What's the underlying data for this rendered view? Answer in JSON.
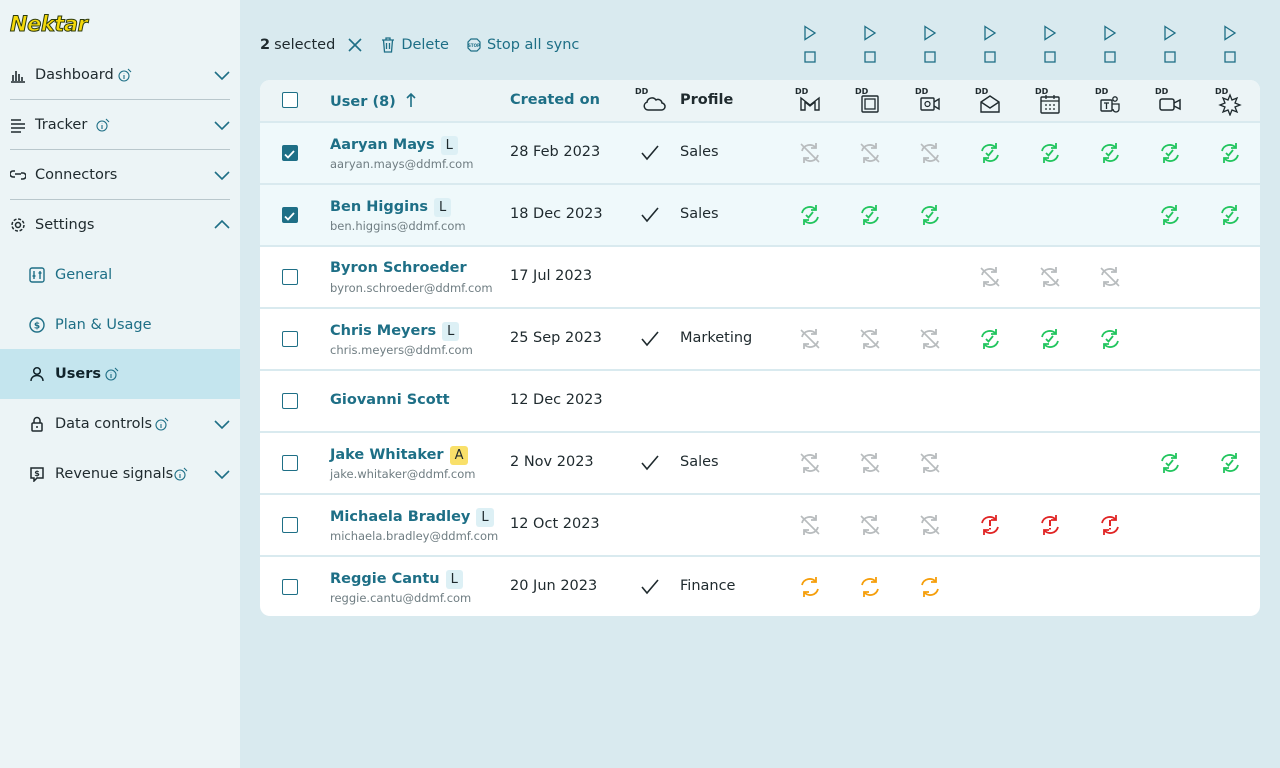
{
  "app": {
    "logo": "Nektar"
  },
  "sidebar": {
    "items": [
      {
        "label": "Dashboard",
        "icon": "bar-chart-icon",
        "info": true,
        "chevron": "down"
      },
      {
        "label": "Tracker",
        "icon": "tracker-list-icon",
        "info": true,
        "chevron": "down"
      },
      {
        "label": "Connectors",
        "icon": "connector-icon",
        "info": false,
        "chevron": "down"
      },
      {
        "label": "Settings",
        "icon": "gear-icon",
        "info": false,
        "chevron": "up"
      },
      {
        "label": "General",
        "icon": "sliders-icon",
        "sub": true
      },
      {
        "label": "Plan & Usage",
        "icon": "dollar-icon",
        "sub": true
      },
      {
        "label": "Users",
        "icon": "user-icon",
        "sub": true,
        "active": true,
        "info": true
      },
      {
        "label": "Data controls",
        "icon": "lock-icon",
        "sub": true,
        "info": true,
        "chevron": "down"
      },
      {
        "label": "Revenue signals",
        "icon": "signal-icon",
        "sub": true,
        "info": true,
        "chevron": "down"
      }
    ]
  },
  "toolbar": {
    "selected_count": "2",
    "selected_label": "selected",
    "delete_label": "Delete",
    "stop_sync_label": "Stop all sync"
  },
  "table": {
    "headers": {
      "user": "User (8)",
      "created": "Created on",
      "profile": "Profile",
      "dd": "DD"
    },
    "sync_columns": [
      {
        "icon": "salesforce-cloud-icon"
      },
      {
        "icon": "gmail-icon"
      },
      {
        "icon": "outlook-icon"
      },
      {
        "icon": "video-meeting-icon"
      },
      {
        "icon": "email-icon"
      },
      {
        "icon": "calendar-icon"
      },
      {
        "icon": "teams-icon"
      },
      {
        "icon": "zoom-icon"
      },
      {
        "icon": "spark-icon"
      }
    ],
    "rows": [
      {
        "name": "Aaryan Mays",
        "badge": "L",
        "email": "aaryan.mays@ddmf.com",
        "created": "28 Feb 2023",
        "dd": true,
        "profile": "Sales",
        "selected": true,
        "sync": [
          "off",
          "off",
          "off",
          "ok",
          "ok",
          "ok",
          "ok",
          "ok"
        ]
      },
      {
        "name": "Ben Higgins",
        "badge": "L",
        "email": "ben.higgins@ddmf.com",
        "created": "18 Dec 2023",
        "dd": true,
        "profile": "Sales",
        "selected": true,
        "sync": [
          "ok",
          "ok",
          "ok",
          "",
          "",
          "",
          "ok",
          "ok"
        ]
      },
      {
        "name": "Byron Schroeder",
        "badge": "",
        "email": "byron.schroeder@ddmf.com",
        "created": "17 Jul 2023",
        "dd": false,
        "profile": "",
        "selected": false,
        "sync": [
          "",
          "",
          "",
          "off",
          "off",
          "off",
          "",
          ""
        ]
      },
      {
        "name": "Chris Meyers",
        "badge": "L",
        "email": "chris.meyers@ddmf.com",
        "created": "25 Sep 2023",
        "dd": true,
        "profile": "Marketing",
        "selected": false,
        "sync": [
          "off",
          "off",
          "off",
          "ok",
          "ok",
          "ok",
          "",
          ""
        ]
      },
      {
        "name": "Giovanni Scott",
        "badge": "",
        "email": "",
        "created": "12 Dec 2023",
        "dd": false,
        "profile": "",
        "selected": false,
        "sync": [
          "",
          "",
          "",
          "",
          "",
          "",
          "",
          ""
        ]
      },
      {
        "name": "Jake Whitaker",
        "badge": "A",
        "email": "jake.whitaker@ddmf.com",
        "created": "2 Nov 2023",
        "dd": true,
        "profile": "Sales",
        "selected": false,
        "sync": [
          "off",
          "off",
          "off",
          "",
          "",
          "",
          "ok",
          "ok"
        ]
      },
      {
        "name": "Michaela Bradley",
        "badge": "L",
        "email": "michaela.bradley@ddmf.com",
        "created": "12 Oct 2023",
        "dd": false,
        "profile": "",
        "selected": false,
        "sync": [
          "off",
          "off",
          "off",
          "error",
          "error",
          "error",
          "",
          ""
        ]
      },
      {
        "name": "Reggie Cantu",
        "badge": "L",
        "email": "reggie.cantu@ddmf.com",
        "created": "20 Jun 2023",
        "dd": true,
        "profile": "Finance",
        "selected": false,
        "sync": [
          "pending",
          "pending",
          "pending",
          "",
          "",
          "",
          "",
          ""
        ]
      }
    ]
  },
  "colors": {
    "accent": "#1e6f86",
    "ok": "#22c55e",
    "off": "#b8bcbe",
    "error": "#e02424",
    "pending": "#f59e0b"
  }
}
